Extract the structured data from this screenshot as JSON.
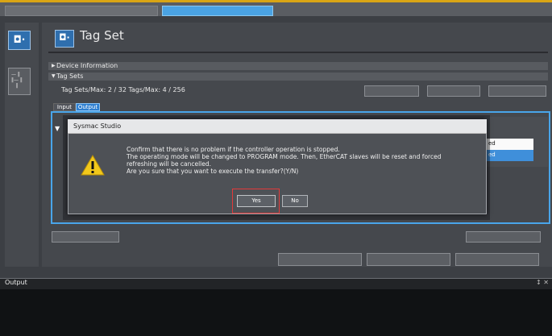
{
  "editor": {
    "title": "Tag Set"
  },
  "sections": {
    "device_information": "Device Information",
    "tag_sets": "Tag Sets"
  },
  "tag_sets_status": "Tag Sets/Max:  2  /  32     Tags/Max:  4  /  256",
  "io_tabs": {
    "input": "Input",
    "output": "Output"
  },
  "table": {
    "cell1": "ed",
    "cell2": "ed"
  },
  "dialog": {
    "title": "Sysmac Studio",
    "icon": "warning-icon",
    "lines": [
      "Confirm that there is no problem if the controller operation is stopped.",
      "The operating mode will be changed to PROGRAM mode. Then, EtherCAT slaves will be reset and forced",
      "refreshing will be cancelled.",
      "Are you sure that you want to execute the transfer?(Y/N)"
    ],
    "yes_label": "Yes",
    "no_label": "No"
  },
  "output_panel": {
    "title": "Output",
    "pin": "↕ ✕"
  },
  "colors": {
    "accent": "#4aa3e4",
    "highlight": "#e33a3a",
    "warning": "#f2c81b"
  }
}
